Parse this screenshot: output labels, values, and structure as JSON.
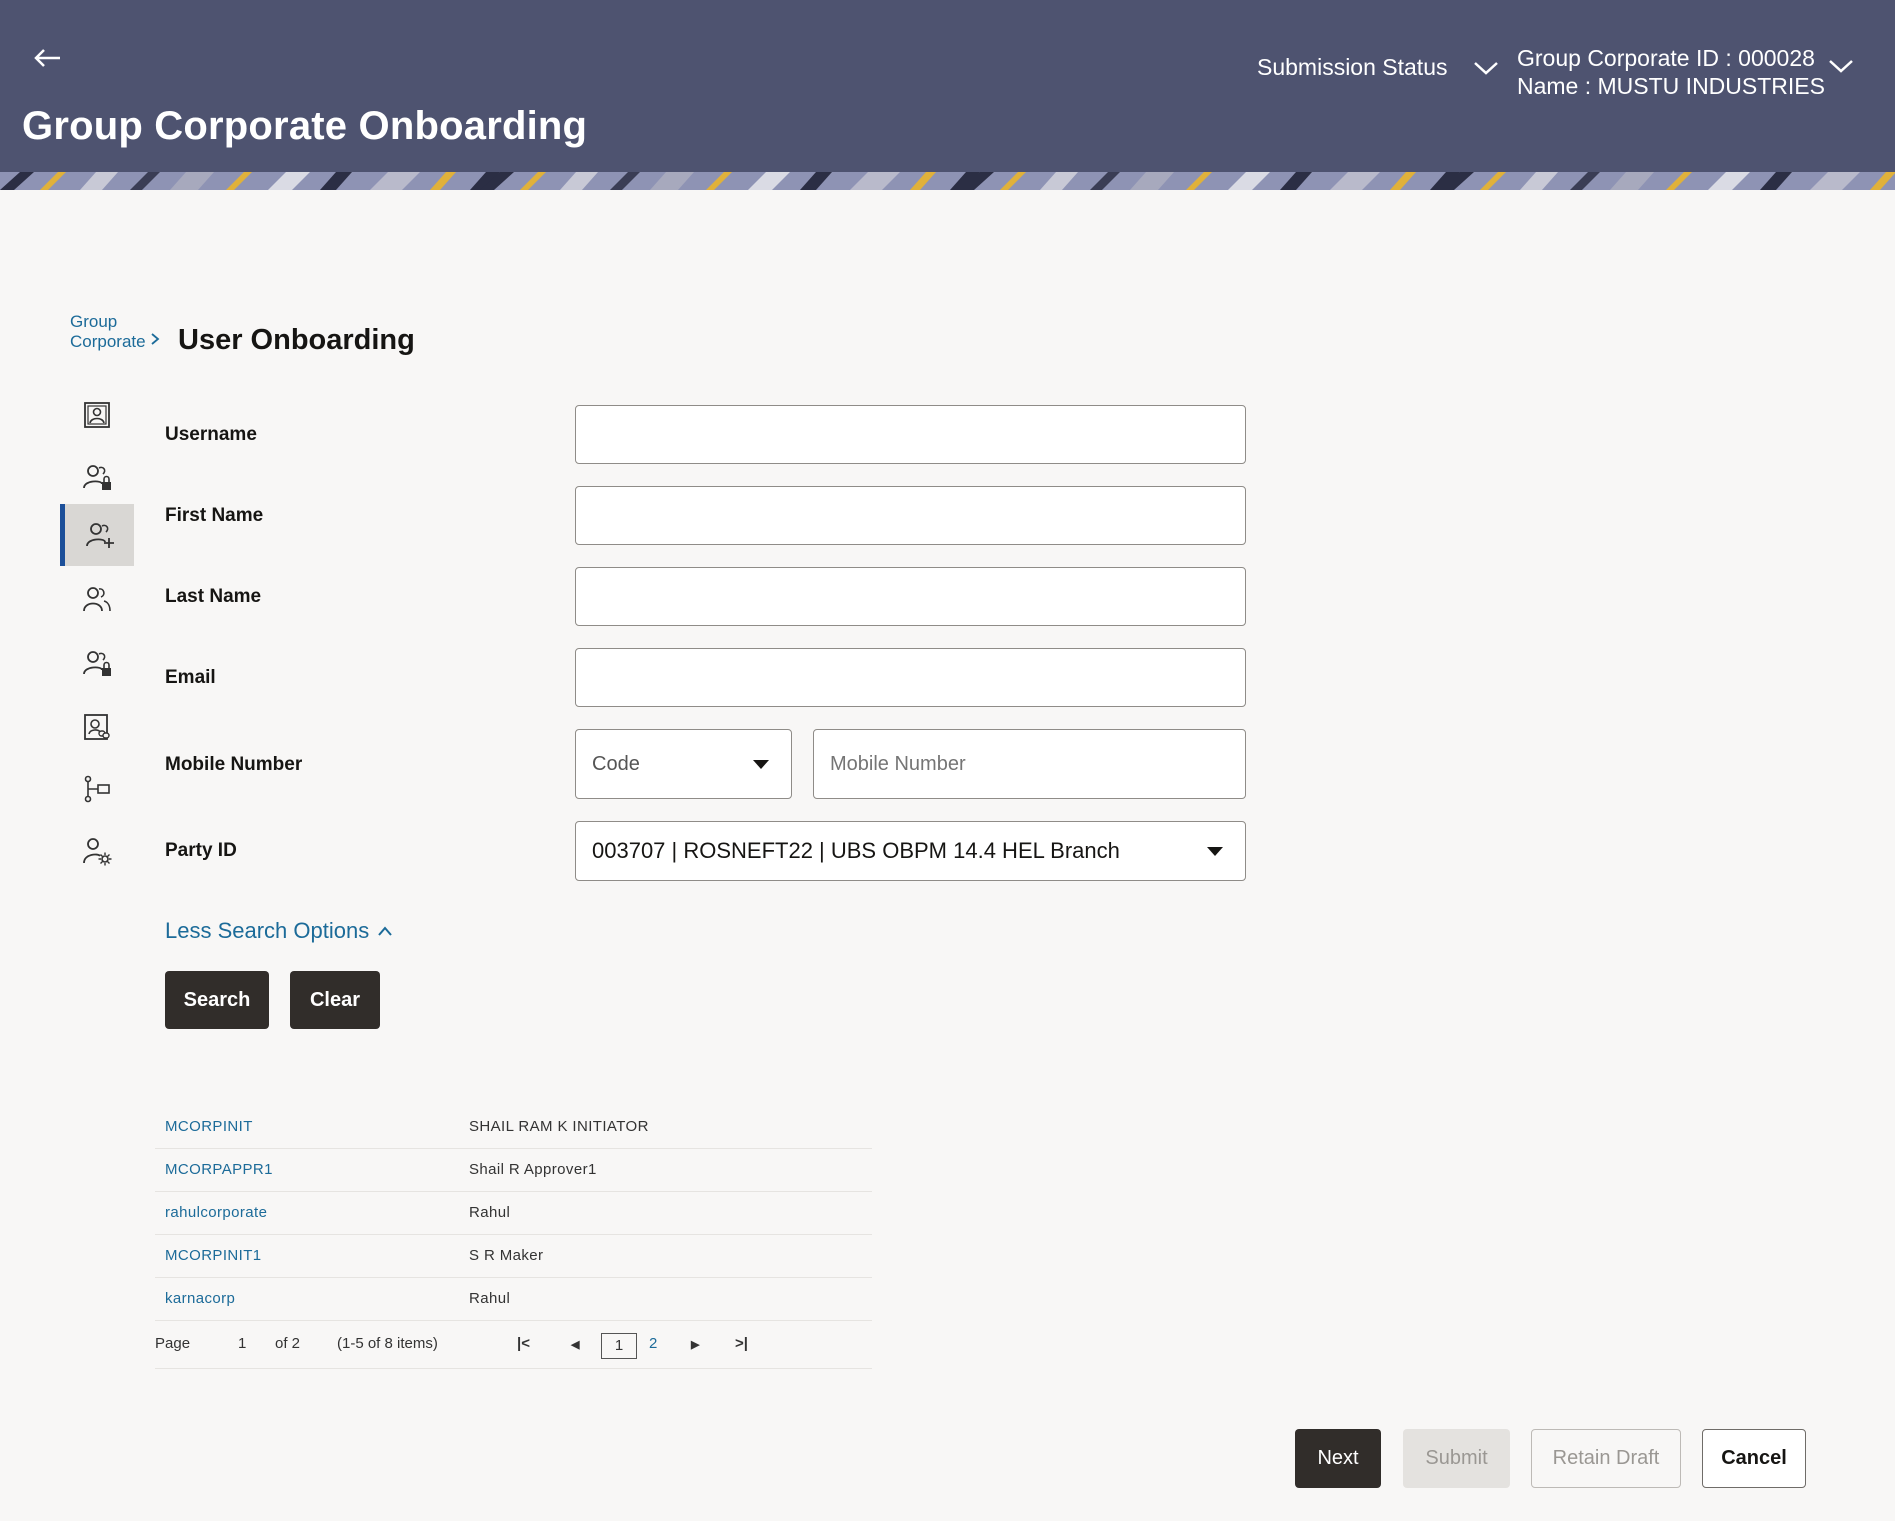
{
  "header": {
    "title": "Group Corporate Onboarding",
    "submission_status": "Submission Status",
    "group_corporate_id": "Group Corporate ID : 000028",
    "group_corporate_name": "Name : MUSTU INDUSTRIES"
  },
  "breadcrumb": {
    "parent": "Group Corporate",
    "current": "User Onboarding"
  },
  "rail": {
    "icons": [
      "profile-card-icon",
      "user-lock-icon",
      "user-add-icon",
      "users-icon",
      "user-lock-icon",
      "document-link-icon",
      "hierarchy-icon",
      "user-settings-icon"
    ],
    "active_index": 2
  },
  "form": {
    "username_label": "Username",
    "first_name_label": "First Name",
    "last_name_label": "Last Name",
    "email_label": "Email",
    "mobile_label": "Mobile Number",
    "code_placeholder": "Code",
    "mobile_placeholder": "Mobile Number",
    "party_label": "Party ID",
    "party_value": "003707 | ROSNEFT22 | UBS OBPM 14.4 HEL Branch",
    "less_options": "Less Search Options",
    "search_button": "Search",
    "clear_button": "Clear"
  },
  "results": {
    "rows": [
      {
        "username": "MCORPINIT",
        "name": "SHAIL RAM K INITIATOR"
      },
      {
        "username": "MCORPAPPR1",
        "name": "Shail R Approver1"
      },
      {
        "username": "rahulcorporate",
        "name": "Rahul"
      },
      {
        "username": "MCORPINIT1",
        "name": "S R Maker"
      },
      {
        "username": "karnacorp",
        "name": "Rahul"
      }
    ],
    "pager": {
      "page_label": "Page",
      "current_page": "1",
      "of_label": "of 2",
      "items_label": "(1-5 of 8 items)",
      "page_1": "1",
      "page_2": "2"
    }
  },
  "footer": {
    "next": "Next",
    "submit": "Submit",
    "retain_draft": "Retain Draft",
    "cancel": "Cancel"
  },
  "colors": {
    "header_bg": "#4e5370",
    "link": "#1c6b99",
    "dark_button": "#312d2a",
    "active_rail": "#1c4f99"
  }
}
